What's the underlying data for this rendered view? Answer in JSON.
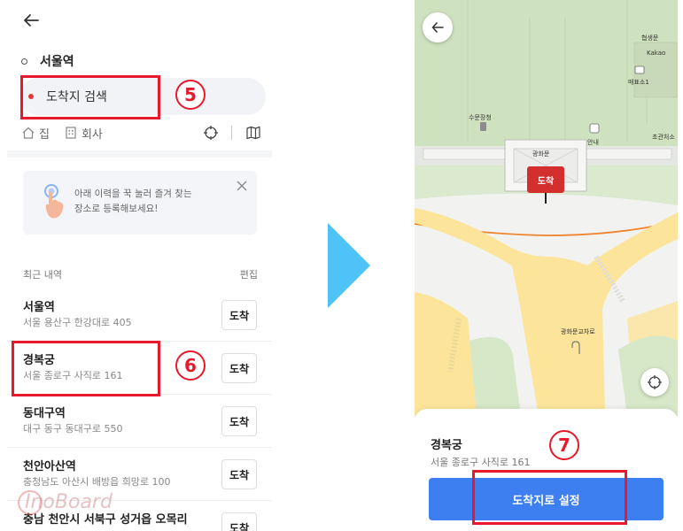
{
  "left_panel": {
    "origin": "서울역",
    "destination_placeholder": "도착지 검색",
    "quick": {
      "home": "집",
      "work": "회사"
    },
    "tip": {
      "line1": "아래 이력을 꾹 눌러 즐겨 찾는",
      "line2": "장소로 등록해보세요!"
    },
    "history_header": {
      "title": "최근 내역",
      "edit": "편집"
    },
    "arrive_label": "도착",
    "history": [
      {
        "name": "서울역",
        "address": "서울 용산구 한강대로 405"
      },
      {
        "name": "경복궁",
        "address": "서울 종로구 사직로 161"
      },
      {
        "name": "동대구역",
        "address": "대구 동구 동대구로 550"
      },
      {
        "name": "천안아산역",
        "address": "충청남도 아산시 배방읍 희망로 100"
      },
      {
        "name": "충남 천안시 서북구 성거읍 오목리",
        "address": ""
      }
    ]
  },
  "markers": {
    "step5": "5",
    "step6": "6",
    "step7": "7"
  },
  "watermark": "InoBoard",
  "map": {
    "pois": {
      "hyeopsaengmun": "협생문",
      "kakao": "Kakao",
      "ticket": "매표소1",
      "sumunjang": "수문장청",
      "info": "안내",
      "gwanghwamun": "광화문",
      "chogeun": "초관처소",
      "intersection": "광화문교차로"
    },
    "pin_label": "도착"
  },
  "sheet": {
    "place_name": "경복궁",
    "place_address": "서울 종로구 사직로 161",
    "set_button": "도착지로 설정"
  },
  "colors": {
    "highlight_red": "#e8192c",
    "button_blue": "#3d7ef0",
    "pin_red": "#d32f2f",
    "arrow_blue": "#4fc3f7"
  }
}
